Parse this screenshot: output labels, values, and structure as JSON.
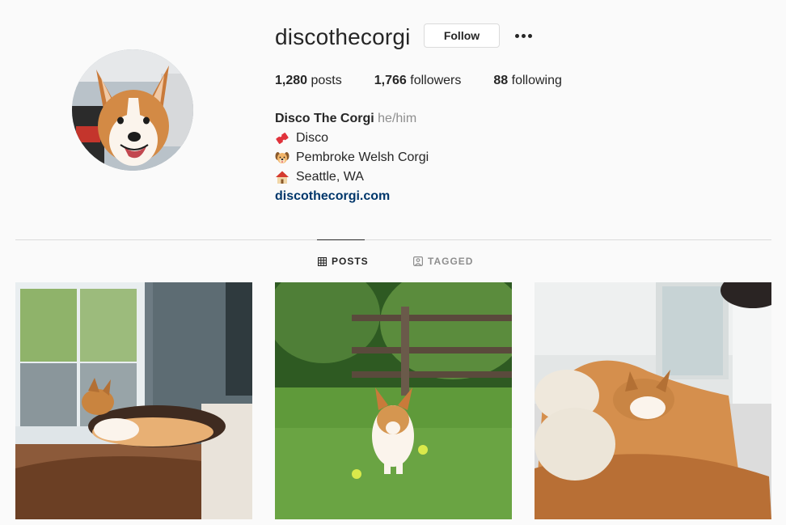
{
  "profile": {
    "username": "discothecorgi",
    "follow_label": "Follow",
    "more_icon": "more-options-icon",
    "stats": {
      "posts_count": "1,280",
      "posts_label": "posts",
      "followers_count": "1,766",
      "followers_label": "followers",
      "following_count": "88",
      "following_label": "following"
    },
    "bio": {
      "name": "Disco The Corgi",
      "pronouns": "he/him",
      "lines": [
        {
          "icon": "ticket-emoji",
          "text": "Disco"
        },
        {
          "icon": "dog-face-emoji",
          "text": "Pembroke Welsh Corgi"
        },
        {
          "icon": "house-emoji",
          "text": "Seattle, WA"
        }
      ],
      "link": "discothecorgi.com"
    }
  },
  "tabs": [
    {
      "label": "POSTS",
      "icon": "grid-icon",
      "active": true
    },
    {
      "label": "TAGGED",
      "icon": "tagged-icon",
      "active": false
    }
  ],
  "colors": {
    "background": "#fafafa",
    "text": "#262626",
    "secondary_text": "#8e8e8e",
    "link": "#00376b",
    "border": "#dbdbdb"
  }
}
